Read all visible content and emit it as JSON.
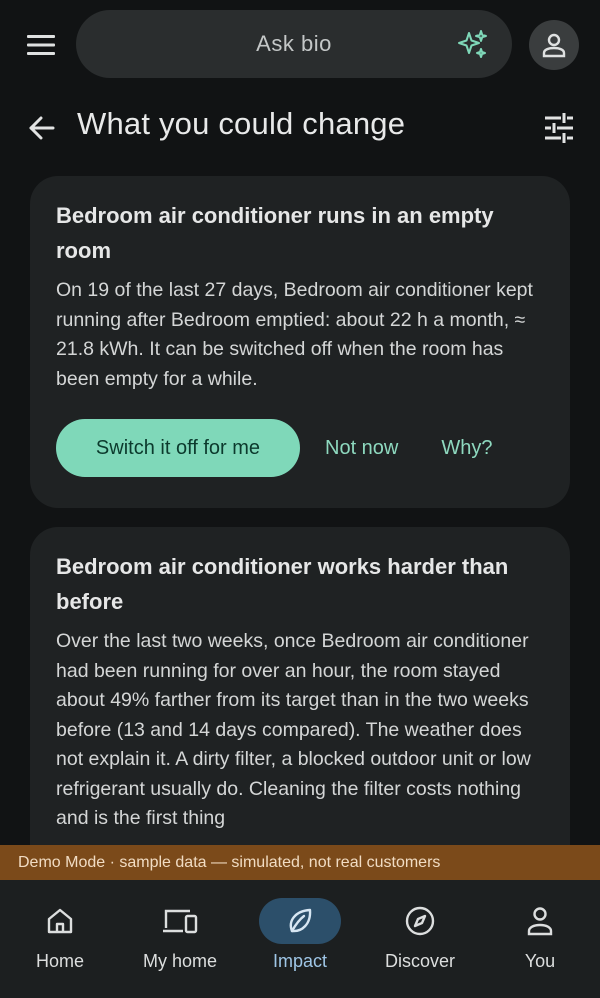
{
  "topbar": {
    "menu_icon": "hamburger-menu-icon",
    "search_label": "Ask bio",
    "sparkle_icon": "sparkle-icon",
    "avatar_icon": "person-icon"
  },
  "header": {
    "back_icon": "arrow-left-icon",
    "title": "What you could change",
    "filter_icon": "tune-sliders-icon"
  },
  "cards": [
    {
      "title": "Bedroom air conditioner runs in an empty room",
      "body": "On 19 of the last 27 days, Bedroom air conditioner kept running after Bedroom emptied: about 22 h a month, ≈ 21.8 kWh. It can be switched off when the room has been empty for a while.",
      "primary_action": "Switch it off for me",
      "secondary_action": "Not now",
      "tertiary_action": "Why?"
    },
    {
      "title": "Bedroom air conditioner works harder than before",
      "body": "Over the last two weeks, once Bedroom air conditioner had been running for over an hour, the room stayed about 49% farther from its target than in the two weeks before (13 and 14 days compared). The weather does not explain it. A dirty filter, a blocked outdoor unit or low refrigerant usually do. Cleaning the filter costs nothing and is the first thing"
    }
  ],
  "demo_banner": "Demo Mode · sample data — simulated, not real customers",
  "nav": [
    {
      "label": "Home",
      "icon": "home-icon",
      "active": false
    },
    {
      "label": "My home",
      "icon": "devices-icon",
      "active": false
    },
    {
      "label": "Impact",
      "icon": "leaf-icon",
      "active": true
    },
    {
      "label": "Discover",
      "icon": "compass-icon",
      "active": false
    },
    {
      "label": "You",
      "icon": "person-icon",
      "active": false
    }
  ],
  "colors": {
    "background": "#111314",
    "card": "#1f2223",
    "accent": "#7fd8b9",
    "accent_text": "#8ed9bf",
    "demo_banner": "#7b4a1a",
    "nav_active": "#2c4f6a"
  }
}
